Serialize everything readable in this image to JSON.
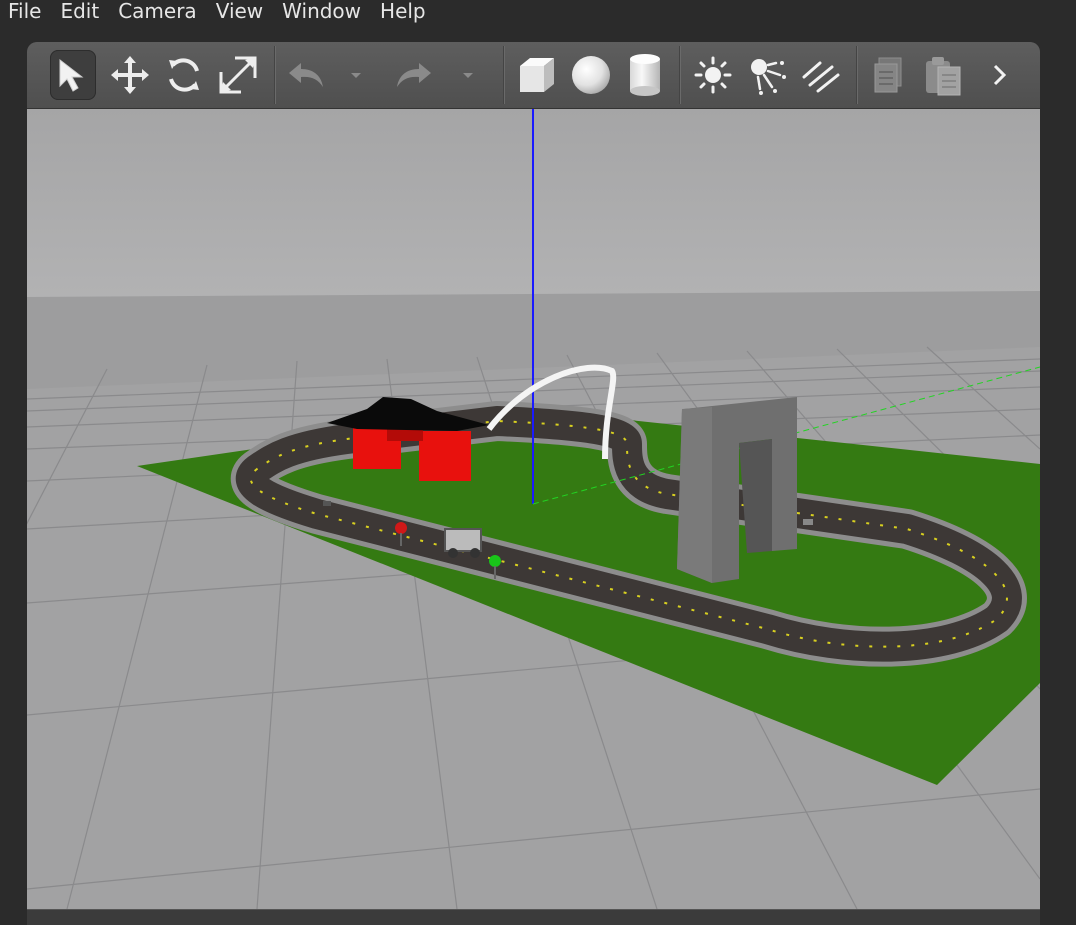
{
  "menubar": {
    "items": [
      "File",
      "Edit",
      "Camera",
      "View",
      "Window",
      "Help"
    ]
  },
  "toolbar": {
    "tools": [
      {
        "name": "select-mode",
        "icon": "arrow-cursor-icon",
        "active": true
      },
      {
        "name": "translate-mode",
        "icon": "move-arrows-icon"
      },
      {
        "name": "rotate-mode",
        "icon": "rotate-icon"
      },
      {
        "name": "scale-mode",
        "icon": "scale-icon"
      },
      {
        "name": "undo",
        "icon": "undo-icon",
        "disabled": true
      },
      {
        "name": "undo-dropdown",
        "icon": "chevron-down-icon",
        "disabled": true
      },
      {
        "name": "redo",
        "icon": "redo-icon",
        "disabled": true
      },
      {
        "name": "redo-dropdown",
        "icon": "chevron-down-icon",
        "disabled": true
      },
      {
        "name": "box-shape",
        "icon": "box-icon"
      },
      {
        "name": "sphere-shape",
        "icon": "sphere-icon"
      },
      {
        "name": "cylinder-shape",
        "icon": "cylinder-icon"
      },
      {
        "name": "point-light",
        "icon": "sun-icon"
      },
      {
        "name": "spot-light",
        "icon": "spotlight-icon"
      },
      {
        "name": "directional-light",
        "icon": "directional-light-icon"
      },
      {
        "name": "copy",
        "icon": "copy-icon",
        "disabled": true
      },
      {
        "name": "paste",
        "icon": "paste-icon",
        "disabled": true
      },
      {
        "name": "more",
        "icon": "chevron-right-icon"
      }
    ]
  },
  "colors": {
    "ground": "#357a12",
    "track": "#3d3836",
    "track_edge": "#8d8d8d",
    "gate_roof": "#0a0a0a",
    "gate_pillars": "#e8110d",
    "arch": "#6f6f6f",
    "z_axis": "#1a1aff",
    "y_axis": "#22d422",
    "sky": "#a6a6a7",
    "floor": "#a3a3a4"
  }
}
